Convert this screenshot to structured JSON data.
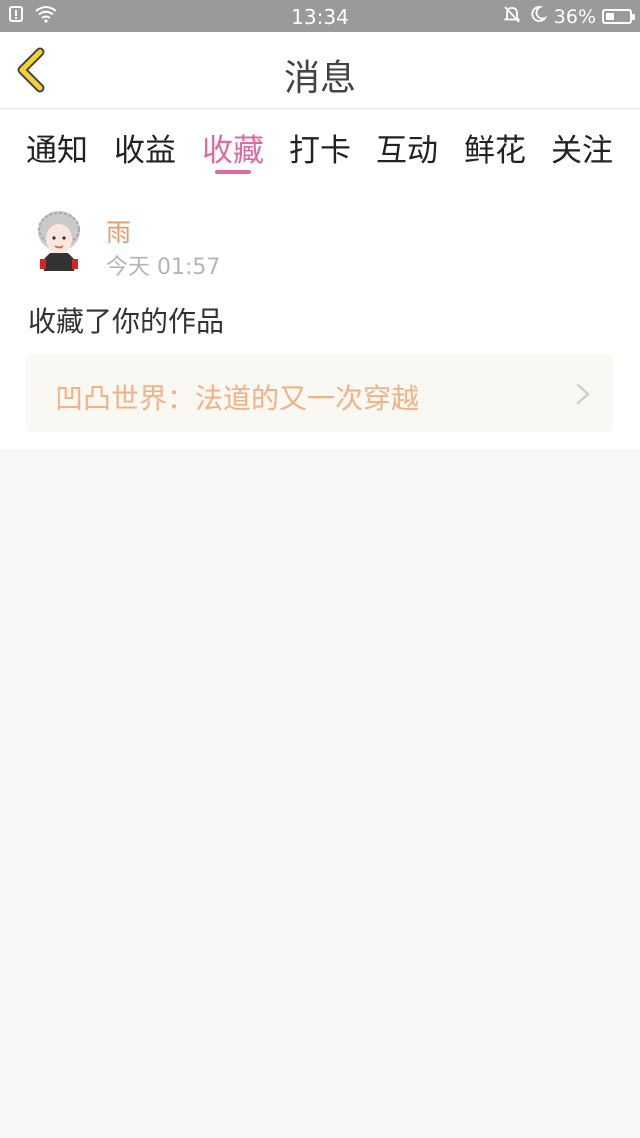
{
  "status_bar": {
    "time": "13:34",
    "battery_percent": "36%",
    "battery_level": 0.36,
    "icons": [
      "notification-icon",
      "wifi-icon",
      "silent-bell-icon",
      "do-not-disturb-moon-icon",
      "battery-icon"
    ]
  },
  "nav": {
    "title": "消息",
    "back_icon": "chevron-left-icon",
    "back_color": "#f4d233"
  },
  "tabs": [
    {
      "label": "通知"
    },
    {
      "label": "收益"
    },
    {
      "label": "收藏",
      "active": true
    },
    {
      "label": "打卡"
    },
    {
      "label": "互动"
    },
    {
      "label": "鲜花"
    },
    {
      "label": "关注"
    }
  ],
  "colors": {
    "accent": "#e06a9f",
    "username": "#e69a6a",
    "work_title": "#f3b285"
  },
  "feed": {
    "items": [
      {
        "user_name": "雨",
        "time": "今天 01:57",
        "action": "收藏了你的作品",
        "work_title": "凹凸世界：法道的又一次穿越"
      }
    ]
  }
}
